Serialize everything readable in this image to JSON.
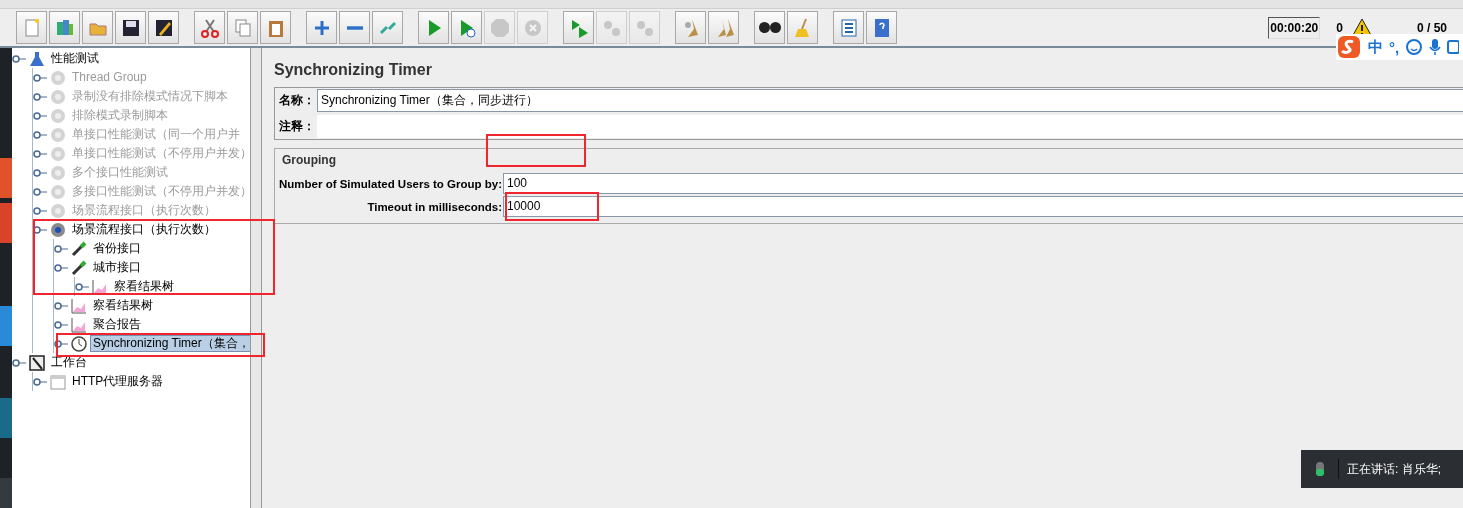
{
  "toolbar": [
    {
      "kind": "new",
      "disabled": false
    },
    {
      "kind": "templates",
      "disabled": false
    },
    {
      "kind": "open",
      "disabled": false
    },
    {
      "kind": "save",
      "disabled": false
    },
    {
      "kind": "save-as",
      "disabled": false
    },
    {
      "kind": "sep"
    },
    {
      "kind": "cut",
      "disabled": false
    },
    {
      "kind": "copy",
      "disabled": false
    },
    {
      "kind": "paste",
      "disabled": false
    },
    {
      "kind": "sep"
    },
    {
      "kind": "expand",
      "disabled": false
    },
    {
      "kind": "collapse",
      "disabled": false
    },
    {
      "kind": "toggle",
      "disabled": false
    },
    {
      "kind": "sep"
    },
    {
      "kind": "start",
      "disabled": false
    },
    {
      "kind": "start-no-timers",
      "disabled": false
    },
    {
      "kind": "stop",
      "disabled": true
    },
    {
      "kind": "shutdown",
      "disabled": true
    },
    {
      "kind": "sep"
    },
    {
      "kind": "remote-start",
      "disabled": false
    },
    {
      "kind": "remote-stop",
      "disabled": true
    },
    {
      "kind": "remote-exit",
      "disabled": true
    },
    {
      "kind": "sep"
    },
    {
      "kind": "clear",
      "disabled": false
    },
    {
      "kind": "clear-all",
      "disabled": false
    },
    {
      "kind": "sep"
    },
    {
      "kind": "search",
      "disabled": false
    },
    {
      "kind": "reset",
      "disabled": false
    },
    {
      "kind": "sep"
    },
    {
      "kind": "functions",
      "disabled": false
    },
    {
      "kind": "help",
      "disabled": false
    }
  ],
  "status": {
    "elapsed": "00:00:20",
    "errors": "0",
    "threads": "0 / 50"
  },
  "tree": [
    {
      "label": "性能测试",
      "kind": "plan",
      "disabled": false,
      "selected": false,
      "children": [
        {
          "label": "Thread Group",
          "kind": "thread",
          "disabled": true,
          "selected": false
        },
        {
          "label": "录制没有排除模式情况下脚本",
          "kind": "thread",
          "disabled": true,
          "selected": false
        },
        {
          "label": "排除模式录制脚本",
          "kind": "thread",
          "disabled": true,
          "selected": false
        },
        {
          "label": "单接口性能测试（同一个用户并",
          "kind": "thread",
          "disabled": true,
          "selected": false
        },
        {
          "label": "单接口性能测试（不停用户并发）",
          "kind": "thread",
          "disabled": true,
          "selected": false
        },
        {
          "label": "多个接口性能测试",
          "kind": "thread",
          "disabled": true,
          "selected": false
        },
        {
          "label": "多接口性能测试（不停用户并发）",
          "kind": "thread",
          "disabled": true,
          "selected": false
        },
        {
          "label": "场景流程接口（执行次数）",
          "kind": "thread",
          "disabled": true,
          "selected": false
        },
        {
          "label": "场景流程接口（执行次数）",
          "kind": "thread",
          "disabled": false,
          "selected": false,
          "children": [
            {
              "label": "省份接口",
              "kind": "sampler",
              "disabled": false,
              "selected": false
            },
            {
              "label": "城市接口",
              "kind": "sampler",
              "disabled": false,
              "selected": false,
              "children": [
                {
                  "label": "察看结果树",
                  "kind": "listener",
                  "disabled": false,
                  "selected": false
                }
              ]
            },
            {
              "label": "察看结果树",
              "kind": "listener",
              "disabled": false,
              "selected": false
            },
            {
              "label": "聚合报告",
              "kind": "listener",
              "disabled": false,
              "selected": false
            },
            {
              "label": "Synchronizing Timer（集合，",
              "kind": "timer",
              "disabled": false,
              "selected": true
            }
          ]
        }
      ]
    },
    {
      "label": "工作台",
      "kind": "workbench",
      "disabled": false,
      "selected": false,
      "children": [
        {
          "label": "HTTP代理服务器",
          "kind": "proxy",
          "disabled": false,
          "selected": false
        }
      ]
    }
  ],
  "panel": {
    "title": "Synchronizing Timer",
    "name_label": "名称：",
    "name_value": "Synchronizing Timer（集合，同步进行）",
    "comment_label": "注释：",
    "group_title": "Grouping",
    "fields": [
      {
        "label": "Number of Simulated Users to Group by:",
        "value": "100"
      },
      {
        "label": "Timeout in milliseconds:",
        "value": "10000"
      }
    ]
  },
  "ime": {
    "mode": "中",
    "punct": "°,"
  },
  "toast": {
    "text": "正在讲话: 肖乐华;"
  }
}
